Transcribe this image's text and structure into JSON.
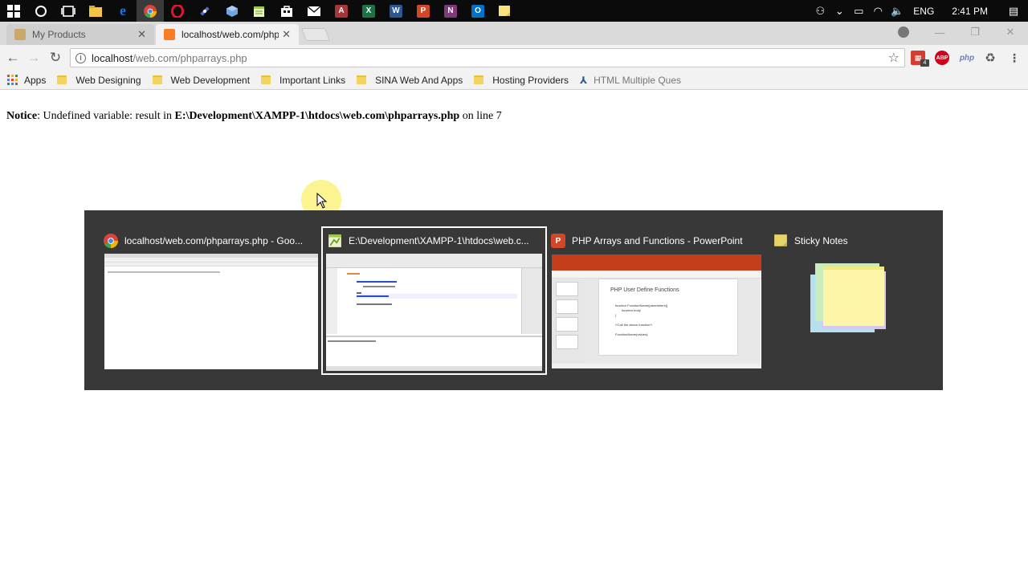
{
  "taskbar": {
    "apps": [
      {
        "name": "windows-start",
        "label": "",
        "color": "#ffffff"
      },
      {
        "name": "cortana",
        "label": "",
        "color": "#ffffff"
      },
      {
        "name": "task-view",
        "label": "",
        "color": "#ffffff"
      },
      {
        "name": "file-explorer",
        "label": "",
        "color": "#f4c542"
      },
      {
        "name": "edge",
        "label": "e",
        "color": "#1e73d9"
      },
      {
        "name": "chrome",
        "label": "",
        "color": "#34a853"
      },
      {
        "name": "opera",
        "label": "O",
        "color": "#e0172b"
      },
      {
        "name": "tool",
        "label": "",
        "color": "#4a6ec8"
      },
      {
        "name": "box",
        "label": "",
        "color": "#6ea6e0"
      },
      {
        "name": "notepad-plus",
        "label": "",
        "color": "#9bc94a"
      },
      {
        "name": "store",
        "label": "",
        "color": "#ffffff"
      },
      {
        "name": "mail",
        "label": "",
        "color": "#ffffff"
      },
      {
        "name": "access",
        "label": "A",
        "color": "#a4373a"
      },
      {
        "name": "excel",
        "label": "X",
        "color": "#1e7145"
      },
      {
        "name": "word",
        "label": "W",
        "color": "#2b5797"
      },
      {
        "name": "powerpoint",
        "label": "P",
        "color": "#d24726"
      },
      {
        "name": "onenote",
        "label": "N",
        "color": "#80397b"
      },
      {
        "name": "outlook",
        "label": "O",
        "color": "#0072c6"
      },
      {
        "name": "sticky-notes",
        "label": "",
        "color": "#f8e47a"
      }
    ],
    "tray": {
      "language": "ENG",
      "time": "2:41 PM"
    }
  },
  "tabs": [
    {
      "label": "My Products",
      "active": false
    },
    {
      "label": "localhost/web.com/phpa",
      "active": true
    }
  ],
  "address": {
    "host": "localhost",
    "path": "/web.com/phparrays.php"
  },
  "bookmarks": {
    "apps_label": "Apps",
    "items": [
      "Web Designing",
      "Web Development",
      "Important Links",
      "SINA Web And Apps",
      "Hosting Providers"
    ],
    "last": "HTML Multiple Ques"
  },
  "page": {
    "notice_label": "Notice",
    "notice_text": ": Undefined variable: result in ",
    "notice_path": "E:\\Development\\XAMPP-1\\htdocs\\web.com\\phparrays.php",
    "notice_line_prefix": " on line ",
    "notice_line": "7"
  },
  "switcher": {
    "windows": [
      {
        "title": "localhost/web.com/phparrays.php - Goo...",
        "app": "chrome",
        "selected": false
      },
      {
        "title": "E:\\Development\\XAMPP-1\\htdocs\\web.c...",
        "app": "notepad++",
        "selected": true
      },
      {
        "title": "PHP Arrays and Functions - PowerPoint",
        "app": "powerpoint",
        "selected": false
      },
      {
        "title": "Sticky Notes",
        "app": "sticky-notes",
        "selected": false
      }
    ],
    "ppt_slide": {
      "title": "PHP User Define Functions",
      "lines": [
        "function FunctionName(parameters){",
        "function body",
        "}",
        "/*Call the above function*/",
        "FunctionName(values);"
      ]
    }
  },
  "colors": {
    "switcher_bg": "#383838",
    "cursor_highlight": "#fbf384",
    "taskbar_bg": "#0b0b0b"
  }
}
